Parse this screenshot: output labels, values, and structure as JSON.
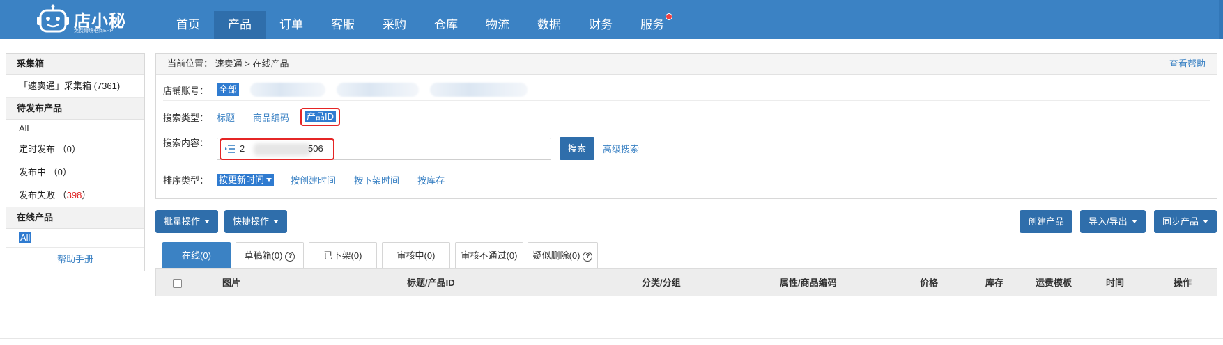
{
  "topbar": {
    "logo_title": "店小秘",
    "logo_subtitle": "免费跨境电商ERP",
    "accent": "#3b82c4",
    "nav": [
      {
        "label": "首页"
      },
      {
        "label": "产品",
        "active": true
      },
      {
        "label": "订单"
      },
      {
        "label": "客服"
      },
      {
        "label": "采购"
      },
      {
        "label": "仓库"
      },
      {
        "label": "物流"
      },
      {
        "label": "数据"
      },
      {
        "label": "财务"
      },
      {
        "label": "服务",
        "has_notification_dot": true
      }
    ]
  },
  "sidebar": {
    "collect_header": "采集箱",
    "collect_item": "「速卖通」采集箱 (7361)",
    "pending_header": "待发布产品",
    "pending_all": "All",
    "scheduled_label": "定时发布",
    "scheduled_count": "（0）",
    "publishing_label": "发布中",
    "publishing_count": "（0）",
    "failed_label": "发布失败",
    "failed_count_open": "（",
    "failed_count": "398",
    "failed_count_close": "）",
    "online_header": "在线产品",
    "online_all": "All",
    "help_link": "帮助手册"
  },
  "panel": {
    "breadcrumb_prefix": "当前位置：",
    "breadcrumb_path": "速卖通 > 在线产品",
    "help_link": "查看帮助",
    "shop_label": "店铺账号：",
    "shop_all": "全部",
    "search_type_label": "搜索类型：",
    "search_types": [
      "标题",
      "商品编码",
      "产品ID"
    ],
    "search_content_label": "搜索内容：",
    "search_value_head": "2",
    "search_value_tail": "506",
    "search_button": "搜索",
    "advanced_search": "高级搜索",
    "sort_label": "排序类型：",
    "sort_active": "按更新时间",
    "sort_options": [
      "按创建时间",
      "按下架时间",
      "按库存"
    ]
  },
  "actions": {
    "batch": "批量操作",
    "quick": "快捷操作",
    "create": "创建产品",
    "import_export": "导入/导出",
    "sync": "同步产品"
  },
  "tabs": [
    {
      "label": "在线(0)",
      "active": true
    },
    {
      "label": "草稿箱(0)",
      "help": true
    },
    {
      "label": "已下架(0)"
    },
    {
      "label": "审核中(0)"
    },
    {
      "label": "审核不通过(0)"
    },
    {
      "label": "疑似删除(0)",
      "help": true
    }
  ],
  "table": {
    "columns": [
      "图片",
      "标题/产品ID",
      "分类/分组",
      "属性/商品编码",
      "价格",
      "库存",
      "运费模板",
      "时间",
      "操作"
    ]
  }
}
